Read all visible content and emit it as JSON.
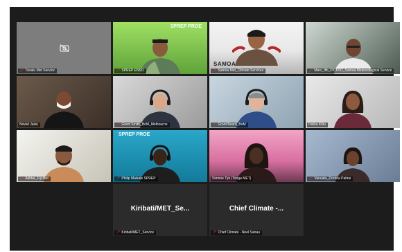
{
  "tiles": [
    {
      "name": "Tuvalu Met Service",
      "camera": "off"
    },
    {
      "name": "SPREP ENSO",
      "badge": "SPREP PROE"
    },
    {
      "name": "Samoa Met_Climate Services",
      "banner": "SAMOA"
    },
    {
      "name": "Marc_Ifiti_PICPIIO_Samoa Meteorological Service"
    },
    {
      "name": "Noviel Jaisu"
    },
    {
      "name": "Grant Smith_BoM_Melbourne"
    },
    {
      "name": "Grant Beard_BoM"
    },
    {
      "name": "Peliku Kiltu"
    },
    {
      "name": "Akhtar_Fiji Met"
    },
    {
      "name": "Philip Malsale SPREP",
      "badge": "SPREP PROE"
    },
    {
      "name": "Simone Tipi (Tonga MET)"
    },
    {
      "name": "Vanuatu_Dorrida Patine"
    },
    {
      "name": ""
    },
    {
      "name": "Kiribati/MET_Service",
      "display": "Kiribati/MET_Se..."
    },
    {
      "name": "Chief Climate - Noel Sanau",
      "display": "Chief Climate -..."
    },
    {
      "name": ""
    }
  ],
  "icons": {
    "mic_muted": "mic-muted-icon",
    "camera_off": "camera-off-icon"
  }
}
